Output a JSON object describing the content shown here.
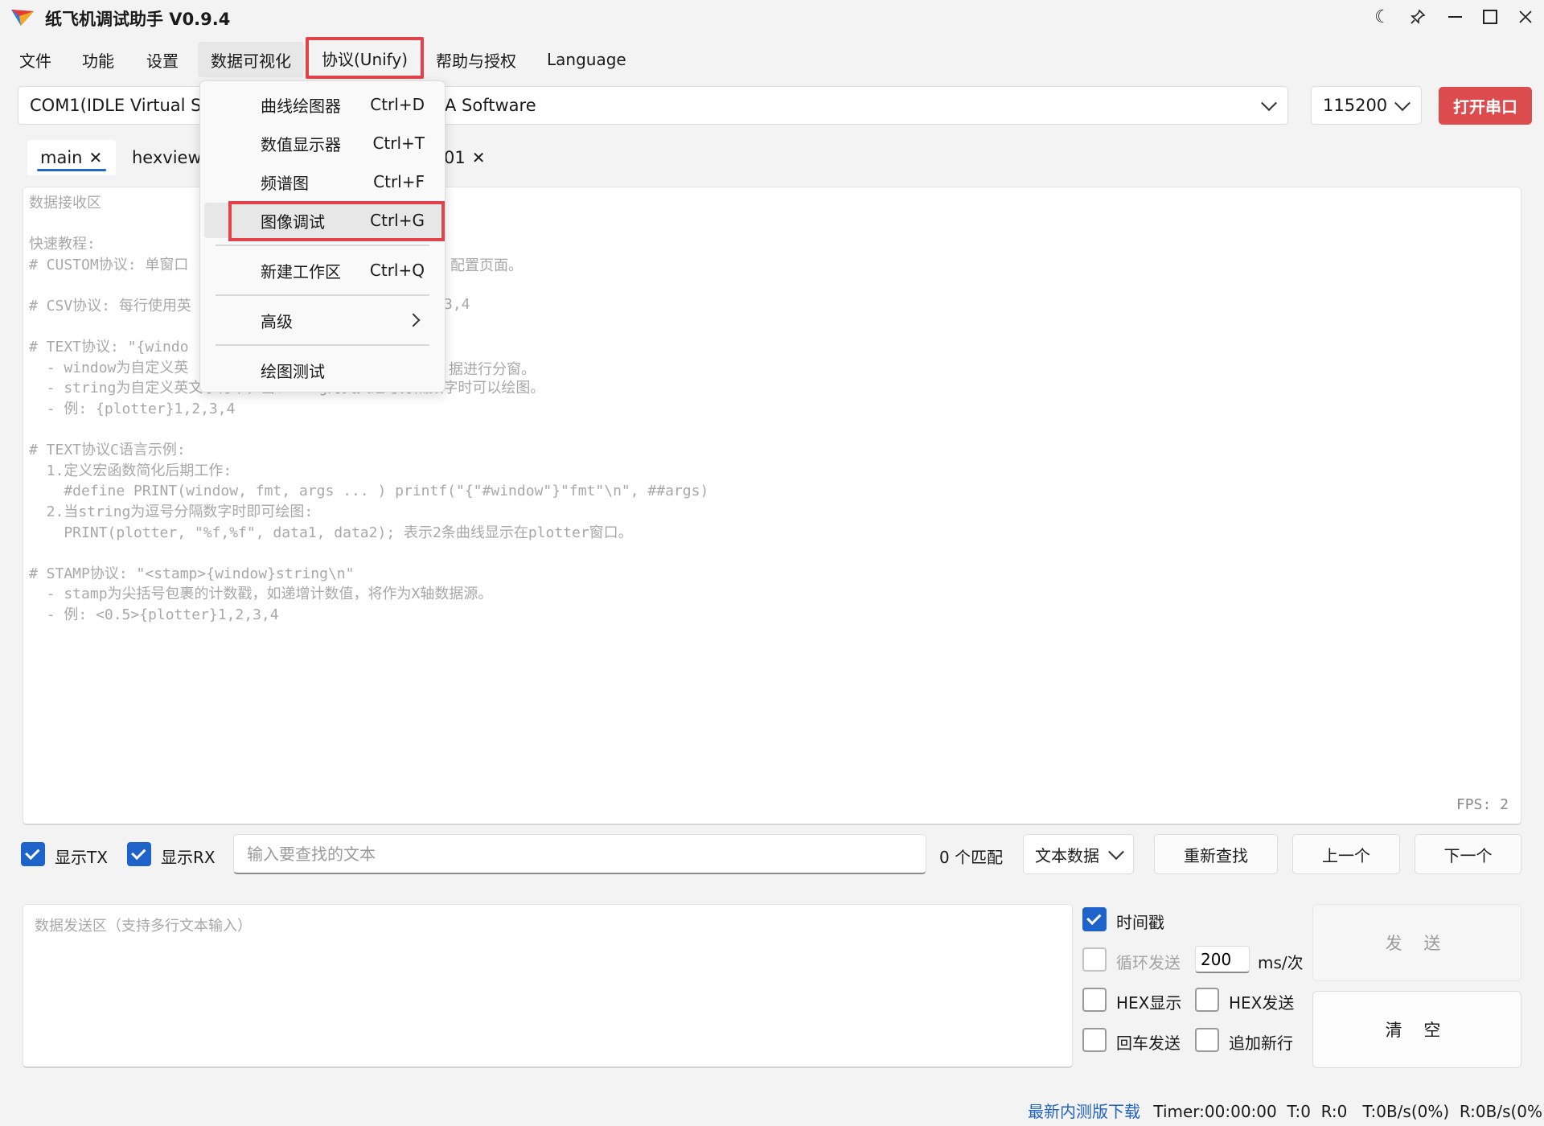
{
  "window": {
    "title": "纸飞机调试助手 V0.9.4",
    "logo_icon": "paper-plane-icon",
    "controls": [
      "moon-icon",
      "pin-icon",
      "minimize-icon",
      "maximize-icon",
      "close-icon"
    ]
  },
  "menubar": {
    "items": [
      "文件",
      "功能",
      "设置",
      "数据可视化",
      "协议(Unify)",
      "帮助与授权",
      "Language"
    ]
  },
  "port": {
    "device_left": "COM1(IDLE  Virtual Se",
    "device_right": "A Software",
    "baud": "115200",
    "open_label": "打开串口"
  },
  "tabs": {
    "main": "main",
    "hexview": "hexview",
    "third_suffix": "01"
  },
  "receive": {
    "lines": [
      "数据接收区",
      "",
      "快速教程:",
      "# CUSTOM协议: 单窗口",
      "",
      "# CSV协议: 每行使用英",
      "",
      "# TEXT协议: \"{windo",
      "  - window为自定义英",
      "  - string为自定义英文字符串，当string为英文逗号分隔数字时可以绘图。",
      "  - 例: {plotter}1,2,3,4",
      "",
      "# TEXT协议C语言示例:",
      "  1.定义宏函数简化后期工作:",
      "    #define PRINT(window, fmt, args ... ) printf(\"{\"#window\"}\"fmt\"\\n\", ##args)",
      "  2.当string为逗号分隔数字时即可绘图:",
      "    PRINT(plotter, \"%f,%f\", data1, data2); 表示2条曲线显示在plotter窗口。",
      "",
      "# STAMP协议: \"<stamp>{window}string\\n\"",
      "  - stamp为尖括号包裹的计数戳，如递增计数值，将作为X轴数据源。",
      "  - 例: <0.5>{plotter}1,2,3,4"
    ],
    "fragment_right_1": "配置页面。",
    "fragment_right_2": "3,4",
    "fragment_right_3": "据进行分窗。",
    "fps": "FPS: 2"
  },
  "search": {
    "show_tx": "显示TX",
    "show_rx": "显示RX",
    "placeholder": "输入要查找的文本",
    "match_count": "0 个匹配",
    "mode": "文本数据",
    "research": "重新查找",
    "prev": "上一个",
    "next": "下一个"
  },
  "send": {
    "placeholder": "数据发送区（支持多行文本输入）",
    "timestamp": "时间戳",
    "loop_send": "循环发送",
    "interval": "200",
    "interval_unit": "ms/次",
    "hex_display": "HEX显示",
    "hex_send": "HEX发送",
    "enter_send": "回车发送",
    "append_newline": "追加新行",
    "send_label": "发 送",
    "clear_label": "清 空"
  },
  "status": {
    "beta_link": "最新内测版下载",
    "text": "Timer:00:00:00  T:0  R:0   T:0B/s(0%)  R:0B/s(0%)"
  },
  "dropdown": {
    "items": [
      {
        "label": "曲线绘图器",
        "shortcut": "Ctrl+D"
      },
      {
        "label": "数值显示器",
        "shortcut": "Ctrl+T"
      },
      {
        "label": "频谱图",
        "shortcut": "Ctrl+F"
      },
      {
        "label": "图像调试",
        "shortcut": "Ctrl+G"
      },
      {
        "label": "新建工作区",
        "shortcut": "Ctrl+Q"
      },
      {
        "label": "高级",
        "shortcut": ""
      },
      {
        "label": "绘图测试",
        "shortcut": ""
      }
    ]
  },
  "colors": {
    "accent": "#1e63c9",
    "open_port": "#dc4c4f",
    "highlight_box": "#e2434b",
    "link": "#2264c2"
  }
}
